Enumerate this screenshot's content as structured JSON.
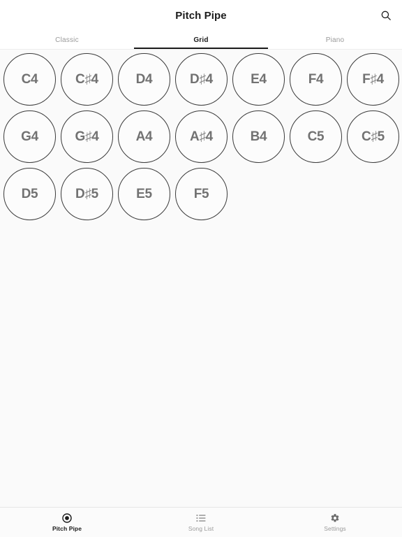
{
  "appbar": {
    "title": "Pitch Pipe",
    "search_icon": "search-icon"
  },
  "tabs": [
    {
      "label": "Classic",
      "active": false
    },
    {
      "label": "Grid",
      "active": true
    },
    {
      "label": "Piano",
      "active": false
    }
  ],
  "grid": {
    "notes": [
      {
        "label": "C4",
        "root": "C",
        "sharp": false,
        "octave": "4"
      },
      {
        "label": "C♯4",
        "root": "C",
        "sharp": true,
        "octave": "4"
      },
      {
        "label": "D4",
        "root": "D",
        "sharp": false,
        "octave": "4"
      },
      {
        "label": "D♯4",
        "root": "D",
        "sharp": true,
        "octave": "4"
      },
      {
        "label": "E4",
        "root": "E",
        "sharp": false,
        "octave": "4"
      },
      {
        "label": "F4",
        "root": "F",
        "sharp": false,
        "octave": "4"
      },
      {
        "label": "F♯4",
        "root": "F",
        "sharp": true,
        "octave": "4"
      },
      {
        "label": "G4",
        "root": "G",
        "sharp": false,
        "octave": "4"
      },
      {
        "label": "G♯4",
        "root": "G",
        "sharp": true,
        "octave": "4"
      },
      {
        "label": "A4",
        "root": "A",
        "sharp": false,
        "octave": "4"
      },
      {
        "label": "A♯4",
        "root": "A",
        "sharp": true,
        "octave": "4"
      },
      {
        "label": "B4",
        "root": "B",
        "sharp": false,
        "octave": "4"
      },
      {
        "label": "C5",
        "root": "C",
        "sharp": false,
        "octave": "5"
      },
      {
        "label": "C♯5",
        "root": "C",
        "sharp": true,
        "octave": "5"
      },
      {
        "label": "D5",
        "root": "D",
        "sharp": false,
        "octave": "5"
      },
      {
        "label": "D♯5",
        "root": "D",
        "sharp": true,
        "octave": "5"
      },
      {
        "label": "E5",
        "root": "E",
        "sharp": false,
        "octave": "5"
      },
      {
        "label": "F5",
        "root": "F",
        "sharp": false,
        "octave": "5"
      }
    ]
  },
  "bottomnav": [
    {
      "label": "Pitch Pipe",
      "icon": "record-circle-icon",
      "active": true
    },
    {
      "label": "Song List",
      "icon": "list-icon",
      "active": false
    },
    {
      "label": "Settings",
      "icon": "gear-icon",
      "active": false
    }
  ],
  "colors": {
    "accent": "#1b1b1b",
    "note_border": "#3a3a3a",
    "note_text": "#727272",
    "muted_text": "#9a9a9a",
    "background": "#fafafa",
    "surface": "#ffffff"
  }
}
